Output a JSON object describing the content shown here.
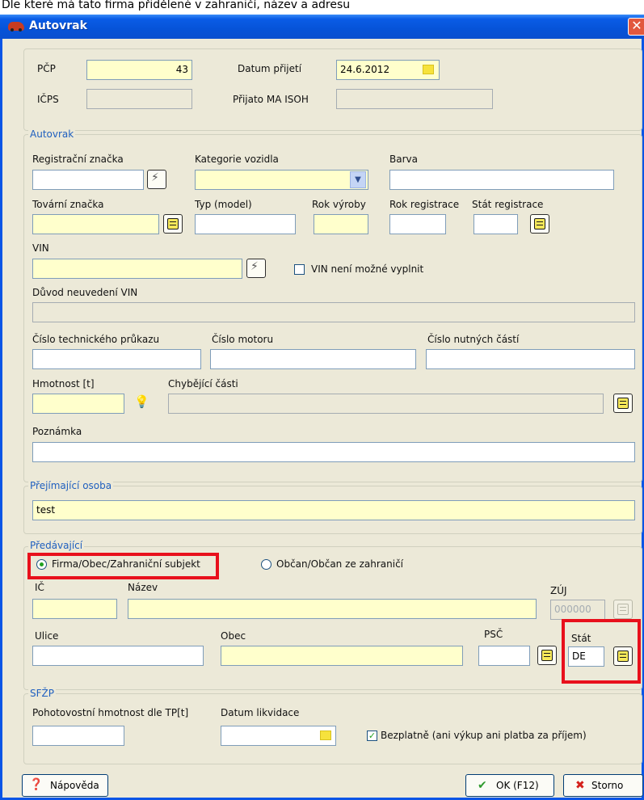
{
  "doc_text": "Dle které má tato firma přidělené v zahraničí, název a adresu",
  "window": {
    "title": "Autovrak",
    "close": "✕"
  },
  "header": {
    "pcp_label": "PČP",
    "pcp_value": "43",
    "datum_prijeti_label": "Datum přijetí",
    "datum_prijeti_value": "24.6.2012",
    "icps_label": "IČPS",
    "icps_value": "",
    "prijato_label": "Přijato MA ISOH",
    "prijato_value": ""
  },
  "autovrak": {
    "title": "Autovrak",
    "registracni_znacka_label": "Registrační značka",
    "kategorie_label": "Kategorie vozidla",
    "barva_label": "Barva",
    "tovarni_znacka_label": "Tovární značka",
    "typ_label": "Typ (model)",
    "rok_vyroby_label": "Rok výroby",
    "rok_registrace_label": "Rok registrace",
    "stat_registrace_label": "Stát registrace",
    "vin_label": "VIN",
    "vin_nelze_label": "VIN není možné vyplnit",
    "duvod_label": "Důvod neuvedení VIN",
    "cislo_tp_label": "Číslo technického průkazu",
    "cislo_motoru_label": "Číslo motoru",
    "cislo_casti_label": "Číslo nutných částí",
    "hmotnost_label": "Hmotnost [t]",
    "chybejici_label": "Chybějící části",
    "poznamka_label": "Poznámka"
  },
  "prejimajici": {
    "title": "Přejímající osoba",
    "value": "test"
  },
  "predavajici": {
    "title": "Předávající",
    "radio_firma": "Firma/Obec/Zahraniční subjekt",
    "radio_obcan": "Občan/Občan ze zahraničí",
    "ic_label": "IČ",
    "nazev_label": "Název",
    "zuj_label": "ZÚJ",
    "zuj_value": "000000",
    "ulice_label": "Ulice",
    "obec_label": "Obec",
    "psc_label": "PSČ",
    "stat_label": "Stát",
    "stat_value": "DE"
  },
  "sfzp": {
    "title": "SFŽP",
    "pohotovostni_label": "Pohotovostní hmotnost dle TP[t]",
    "datum_likvidace_label": "Datum likvidace",
    "bezplatne_label": "Bezplatně (ani výkup ani platba za příjem)"
  },
  "buttons": {
    "help": "Nápověda",
    "ok": "OK (F12)",
    "cancel": "Storno"
  },
  "colors": {
    "titlebar": "#0a5ce6",
    "required": "#ffffcc",
    "highlight": "#e8101c",
    "group_title": "#1f5fbf"
  }
}
